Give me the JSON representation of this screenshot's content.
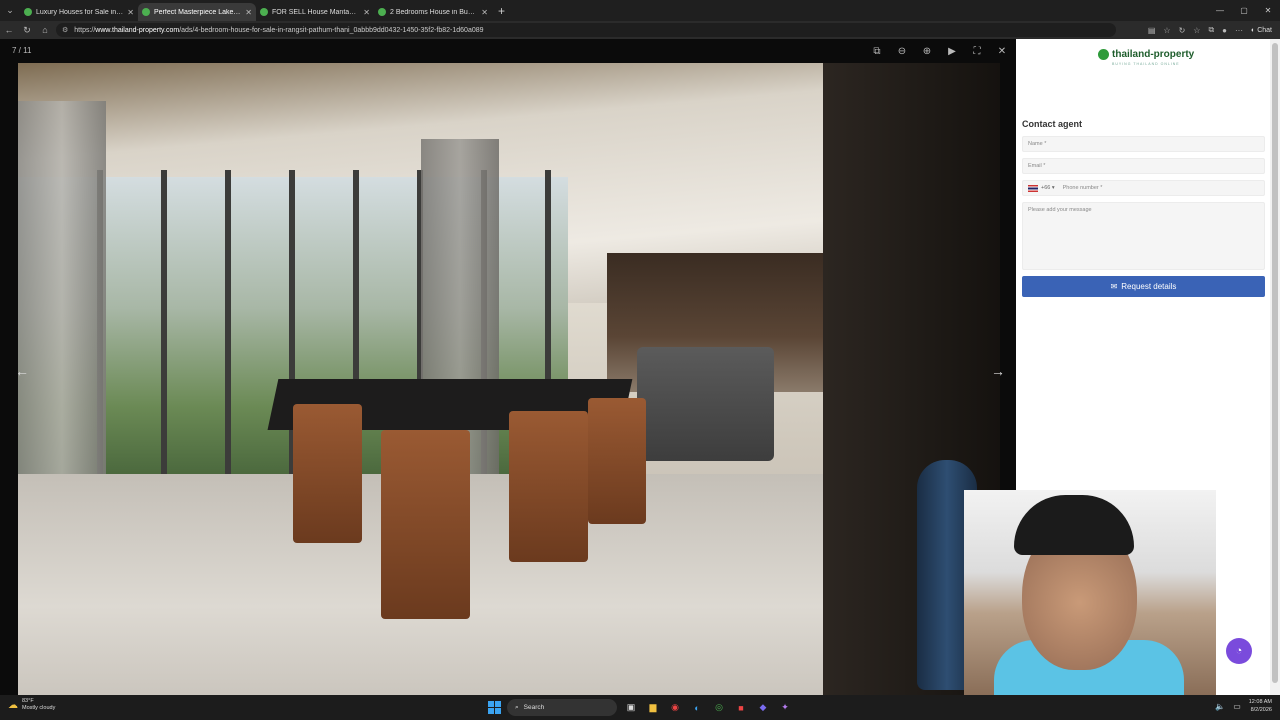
{
  "tabs": [
    {
      "label": "Luxury Houses for Sale in Pathum",
      "active": false
    },
    {
      "label": "Perfect Masterpiece Lakeside Ran",
      "active": true
    },
    {
      "label": "FOR SELL House Mantana Rangsit",
      "active": false
    },
    {
      "label": "2 Bedrooms House in Bueng Nam",
      "active": false
    }
  ],
  "address": {
    "prefix": "https://",
    "host": "www.thailand-property.com",
    "path": "/ads/4-bedroom-house-for-sale-in-rangsit-pathum-thani_0abbb9dd0432-1450-35f2-fb82-1d60a089"
  },
  "toolbar": {
    "chat_label": "Chat"
  },
  "viewer": {
    "counter": "7 / 11"
  },
  "brand": {
    "name": "thailand-property",
    "tagline": "BUYING THAILAND ONLINE"
  },
  "contact": {
    "title": "Contact agent",
    "name_placeholder": "Name *",
    "email_placeholder": "Email *",
    "country_code": "+66",
    "phone_placeholder": "Phone number *",
    "message_placeholder": "Please add your message",
    "request_label": "Request details"
  },
  "taskbar": {
    "temperature": "83°F",
    "weather": "Mostly cloudy",
    "search_label": "Search",
    "time": "12:08 AM",
    "date": "8/2/2026"
  },
  "colors": {
    "accent": "#3a63b6",
    "brand": "#2e9a3a"
  }
}
